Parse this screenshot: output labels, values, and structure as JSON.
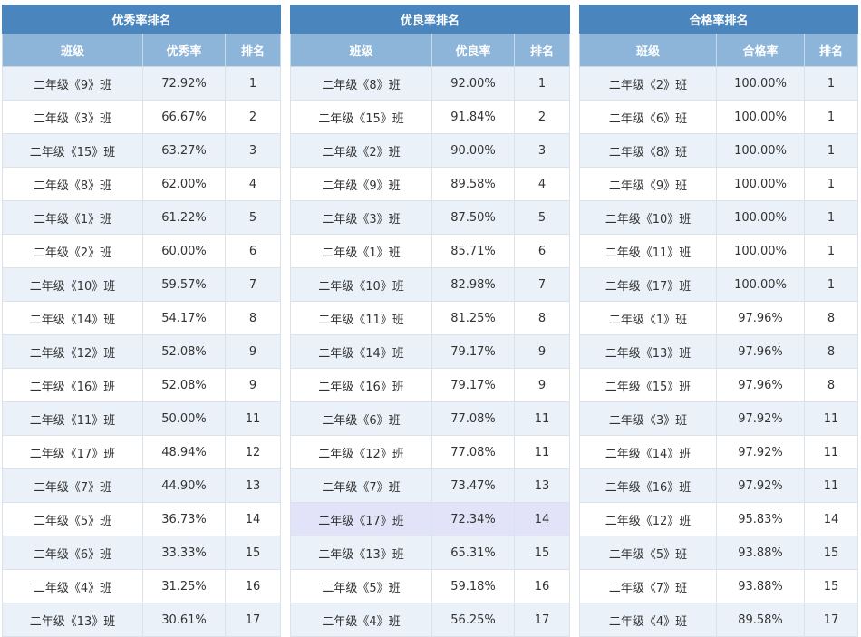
{
  "panels": [
    {
      "title": "优秀率排名",
      "headers": [
        "班级",
        "优秀率",
        "排名"
      ],
      "rows": [
        [
          "二年级《9》班",
          "72.92%",
          "1"
        ],
        [
          "二年级《3》班",
          "66.67%",
          "2"
        ],
        [
          "二年级《15》班",
          "63.27%",
          "3"
        ],
        [
          "二年级《8》班",
          "62.00%",
          "4"
        ],
        [
          "二年级《1》班",
          "61.22%",
          "5"
        ],
        [
          "二年级《2》班",
          "60.00%",
          "6"
        ],
        [
          "二年级《10》班",
          "59.57%",
          "7"
        ],
        [
          "二年级《14》班",
          "54.17%",
          "8"
        ],
        [
          "二年级《12》班",
          "52.08%",
          "9"
        ],
        [
          "二年级《16》班",
          "52.08%",
          "9"
        ],
        [
          "二年级《11》班",
          "50.00%",
          "11"
        ],
        [
          "二年级《17》班",
          "48.94%",
          "12"
        ],
        [
          "二年级《7》班",
          "44.90%",
          "13"
        ],
        [
          "二年级《5》班",
          "36.73%",
          "14"
        ],
        [
          "二年级《6》班",
          "33.33%",
          "15"
        ],
        [
          "二年级《4》班",
          "31.25%",
          "16"
        ],
        [
          "二年级《13》班",
          "30.61%",
          "17"
        ]
      ]
    },
    {
      "title": "优良率排名",
      "headers": [
        "班级",
        "优良率",
        "排名"
      ],
      "rows": [
        [
          "二年级《8》班",
          "92.00%",
          "1"
        ],
        [
          "二年级《15》班",
          "91.84%",
          "2"
        ],
        [
          "二年级《2》班",
          "90.00%",
          "3"
        ],
        [
          "二年级《9》班",
          "89.58%",
          "4"
        ],
        [
          "二年级《3》班",
          "87.50%",
          "5"
        ],
        [
          "二年级《1》班",
          "85.71%",
          "6"
        ],
        [
          "二年级《10》班",
          "82.98%",
          "7"
        ],
        [
          "二年级《11》班",
          "81.25%",
          "8"
        ],
        [
          "二年级《14》班",
          "79.17%",
          "9"
        ],
        [
          "二年级《16》班",
          "79.17%",
          "9"
        ],
        [
          "二年级《6》班",
          "77.08%",
          "11"
        ],
        [
          "二年级《12》班",
          "77.08%",
          "11"
        ],
        [
          "二年级《7》班",
          "73.47%",
          "13"
        ],
        [
          "二年级《17》班",
          "72.34%",
          "14"
        ],
        [
          "二年级《13》班",
          "65.31%",
          "15"
        ],
        [
          "二年级《5》班",
          "59.18%",
          "16"
        ],
        [
          "二年级《4》班",
          "56.25%",
          "17"
        ]
      ]
    },
    {
      "title": "合格率排名",
      "headers": [
        "班级",
        "合格率",
        "排名"
      ],
      "rows": [
        [
          "二年级《2》班",
          "100.00%",
          "1"
        ],
        [
          "二年级《6》班",
          "100.00%",
          "1"
        ],
        [
          "二年级《8》班",
          "100.00%",
          "1"
        ],
        [
          "二年级《9》班",
          "100.00%",
          "1"
        ],
        [
          "二年级《10》班",
          "100.00%",
          "1"
        ],
        [
          "二年级《11》班",
          "100.00%",
          "1"
        ],
        [
          "二年级《17》班",
          "100.00%",
          "1"
        ],
        [
          "二年级《1》班",
          "97.96%",
          "8"
        ],
        [
          "二年级《13》班",
          "97.96%",
          "8"
        ],
        [
          "二年级《15》班",
          "97.96%",
          "8"
        ],
        [
          "二年级《3》班",
          "97.92%",
          "11"
        ],
        [
          "二年级《14》班",
          "97.92%",
          "11"
        ],
        [
          "二年级《16》班",
          "97.92%",
          "11"
        ],
        [
          "二年级《12》班",
          "95.83%",
          "14"
        ],
        [
          "二年级《5》班",
          "93.88%",
          "15"
        ],
        [
          "二年级《7》班",
          "93.88%",
          "15"
        ],
        [
          "二年级《4》班",
          "89.58%",
          "17"
        ]
      ]
    }
  ],
  "colors": {
    "title_bg": "#4a86bd",
    "header_bg": "#8db4d9",
    "row_alt_bg": "#eaf1f8",
    "row_bg": "#ffffff",
    "highlight_bg": "#e2e2f8"
  }
}
